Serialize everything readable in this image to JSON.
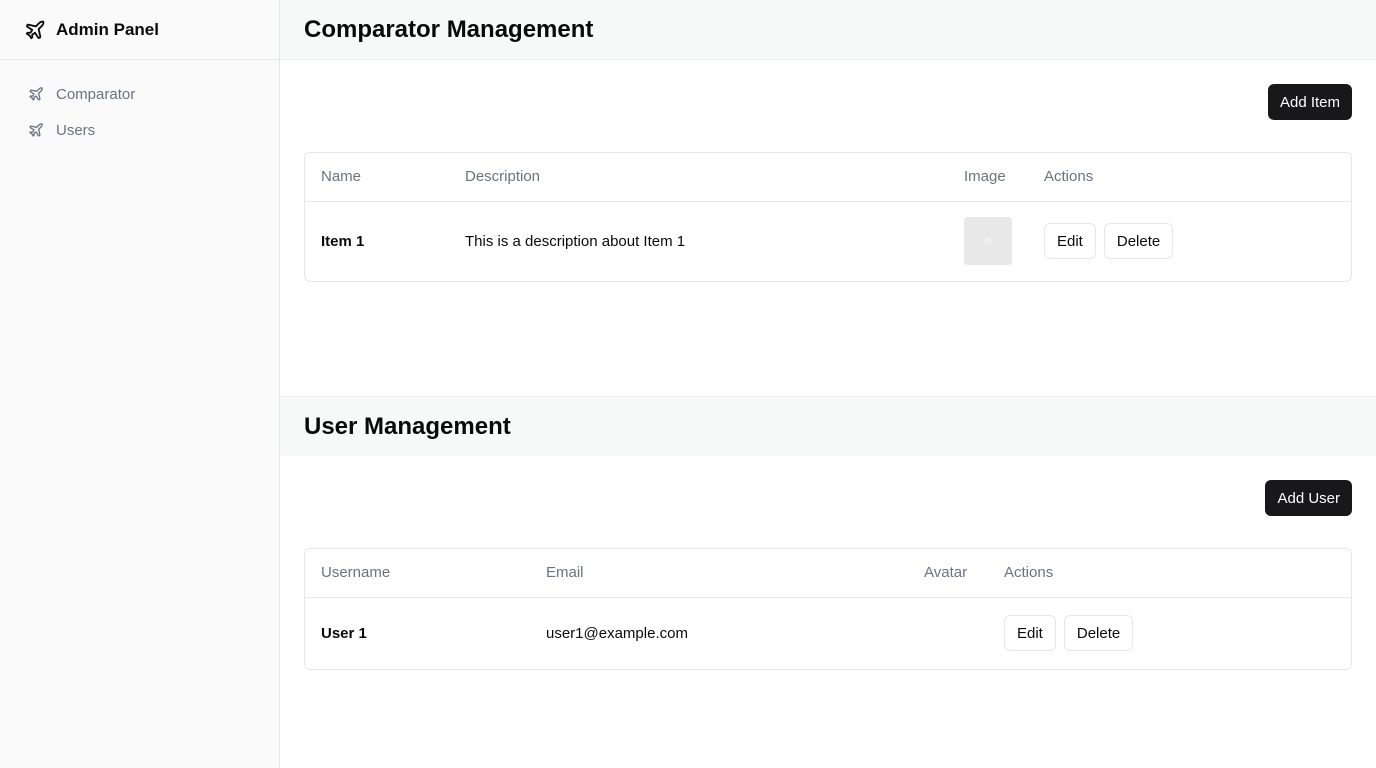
{
  "sidebar": {
    "brand_title": "Admin Panel",
    "brand_icon": "plane-icon",
    "items": [
      {
        "label": "Comparator",
        "icon": "plane-icon"
      },
      {
        "label": "Users",
        "icon": "plane-icon"
      }
    ]
  },
  "comparator": {
    "title": "Comparator Management",
    "add_label": "Add Item",
    "columns": [
      "Name",
      "Description",
      "Image",
      "Actions"
    ],
    "rows": [
      {
        "name": "Item 1",
        "description": "This is a description about Item 1",
        "edit_label": "Edit",
        "delete_label": "Delete"
      }
    ]
  },
  "users": {
    "title": "User Management",
    "add_label": "Add User",
    "columns": [
      "Username",
      "Email",
      "Avatar",
      "Actions"
    ],
    "rows": [
      {
        "username": "User 1",
        "email": "user1@example.com",
        "edit_label": "Edit",
        "delete_label": "Delete"
      }
    ]
  },
  "colors": {
    "primary_button": "#18181b",
    "sidebar_bg": "#fafafa",
    "muted_text": "#6b7280",
    "border": "#e5e7eb"
  }
}
